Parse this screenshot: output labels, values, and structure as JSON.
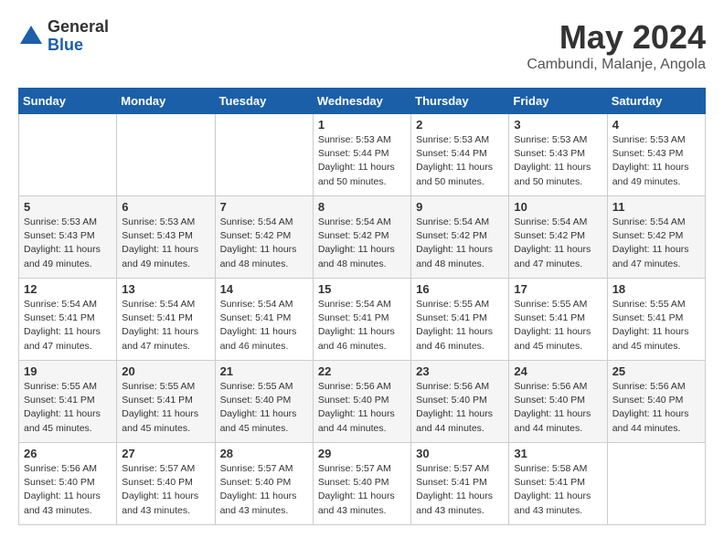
{
  "header": {
    "logo_general": "General",
    "logo_blue": "Blue",
    "month_year": "May 2024",
    "location": "Cambundi, Malanje, Angola"
  },
  "days_of_week": [
    "Sunday",
    "Monday",
    "Tuesday",
    "Wednesday",
    "Thursday",
    "Friday",
    "Saturday"
  ],
  "weeks": [
    [
      {
        "day": "",
        "info": ""
      },
      {
        "day": "",
        "info": ""
      },
      {
        "day": "",
        "info": ""
      },
      {
        "day": "1",
        "info": "Sunrise: 5:53 AM\nSunset: 5:44 PM\nDaylight: 11 hours\nand 50 minutes."
      },
      {
        "day": "2",
        "info": "Sunrise: 5:53 AM\nSunset: 5:44 PM\nDaylight: 11 hours\nand 50 minutes."
      },
      {
        "day": "3",
        "info": "Sunrise: 5:53 AM\nSunset: 5:43 PM\nDaylight: 11 hours\nand 50 minutes."
      },
      {
        "day": "4",
        "info": "Sunrise: 5:53 AM\nSunset: 5:43 PM\nDaylight: 11 hours\nand 49 minutes."
      }
    ],
    [
      {
        "day": "5",
        "info": "Sunrise: 5:53 AM\nSunset: 5:43 PM\nDaylight: 11 hours\nand 49 minutes."
      },
      {
        "day": "6",
        "info": "Sunrise: 5:53 AM\nSunset: 5:43 PM\nDaylight: 11 hours\nand 49 minutes."
      },
      {
        "day": "7",
        "info": "Sunrise: 5:54 AM\nSunset: 5:42 PM\nDaylight: 11 hours\nand 48 minutes."
      },
      {
        "day": "8",
        "info": "Sunrise: 5:54 AM\nSunset: 5:42 PM\nDaylight: 11 hours\nand 48 minutes."
      },
      {
        "day": "9",
        "info": "Sunrise: 5:54 AM\nSunset: 5:42 PM\nDaylight: 11 hours\nand 48 minutes."
      },
      {
        "day": "10",
        "info": "Sunrise: 5:54 AM\nSunset: 5:42 PM\nDaylight: 11 hours\nand 47 minutes."
      },
      {
        "day": "11",
        "info": "Sunrise: 5:54 AM\nSunset: 5:42 PM\nDaylight: 11 hours\nand 47 minutes."
      }
    ],
    [
      {
        "day": "12",
        "info": "Sunrise: 5:54 AM\nSunset: 5:41 PM\nDaylight: 11 hours\nand 47 minutes."
      },
      {
        "day": "13",
        "info": "Sunrise: 5:54 AM\nSunset: 5:41 PM\nDaylight: 11 hours\nand 47 minutes."
      },
      {
        "day": "14",
        "info": "Sunrise: 5:54 AM\nSunset: 5:41 PM\nDaylight: 11 hours\nand 46 minutes."
      },
      {
        "day": "15",
        "info": "Sunrise: 5:54 AM\nSunset: 5:41 PM\nDaylight: 11 hours\nand 46 minutes."
      },
      {
        "day": "16",
        "info": "Sunrise: 5:55 AM\nSunset: 5:41 PM\nDaylight: 11 hours\nand 46 minutes."
      },
      {
        "day": "17",
        "info": "Sunrise: 5:55 AM\nSunset: 5:41 PM\nDaylight: 11 hours\nand 45 minutes."
      },
      {
        "day": "18",
        "info": "Sunrise: 5:55 AM\nSunset: 5:41 PM\nDaylight: 11 hours\nand 45 minutes."
      }
    ],
    [
      {
        "day": "19",
        "info": "Sunrise: 5:55 AM\nSunset: 5:41 PM\nDaylight: 11 hours\nand 45 minutes."
      },
      {
        "day": "20",
        "info": "Sunrise: 5:55 AM\nSunset: 5:41 PM\nDaylight: 11 hours\nand 45 minutes."
      },
      {
        "day": "21",
        "info": "Sunrise: 5:55 AM\nSunset: 5:40 PM\nDaylight: 11 hours\nand 45 minutes."
      },
      {
        "day": "22",
        "info": "Sunrise: 5:56 AM\nSunset: 5:40 PM\nDaylight: 11 hours\nand 44 minutes."
      },
      {
        "day": "23",
        "info": "Sunrise: 5:56 AM\nSunset: 5:40 PM\nDaylight: 11 hours\nand 44 minutes."
      },
      {
        "day": "24",
        "info": "Sunrise: 5:56 AM\nSunset: 5:40 PM\nDaylight: 11 hours\nand 44 minutes."
      },
      {
        "day": "25",
        "info": "Sunrise: 5:56 AM\nSunset: 5:40 PM\nDaylight: 11 hours\nand 44 minutes."
      }
    ],
    [
      {
        "day": "26",
        "info": "Sunrise: 5:56 AM\nSunset: 5:40 PM\nDaylight: 11 hours\nand 43 minutes."
      },
      {
        "day": "27",
        "info": "Sunrise: 5:57 AM\nSunset: 5:40 PM\nDaylight: 11 hours\nand 43 minutes."
      },
      {
        "day": "28",
        "info": "Sunrise: 5:57 AM\nSunset: 5:40 PM\nDaylight: 11 hours\nand 43 minutes."
      },
      {
        "day": "29",
        "info": "Sunrise: 5:57 AM\nSunset: 5:40 PM\nDaylight: 11 hours\nand 43 minutes."
      },
      {
        "day": "30",
        "info": "Sunrise: 5:57 AM\nSunset: 5:41 PM\nDaylight: 11 hours\nand 43 minutes."
      },
      {
        "day": "31",
        "info": "Sunrise: 5:58 AM\nSunset: 5:41 PM\nDaylight: 11 hours\nand 43 minutes."
      },
      {
        "day": "",
        "info": ""
      }
    ]
  ]
}
